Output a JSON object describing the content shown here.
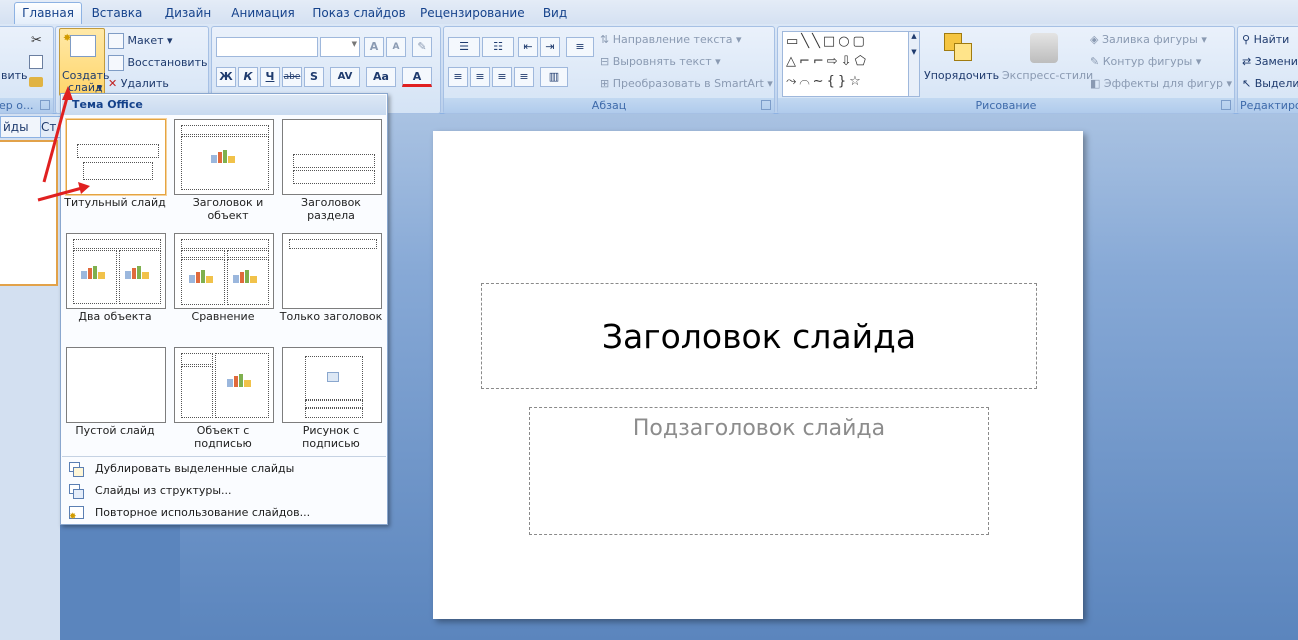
{
  "tabs": [
    "Главная",
    "Вставка",
    "Дизайн",
    "Анимация",
    "Показ слайдов",
    "Рецензирование",
    "Вид"
  ],
  "ribbon": {
    "clipboard": {
      "paste_partial": "вить",
      "group_partial": "ер о..."
    },
    "slides": {
      "create_line1": "Создать",
      "create_line2": "слайд",
      "layout": "Макет",
      "reset": "Восстановить",
      "delete": "Удалить"
    },
    "font": {
      "grow": "A",
      "shrink": "A",
      "bold": "Ж",
      "italic": "К",
      "underline": "Ч",
      "strike": "abe",
      "shadow": "S",
      "spacing": "AV",
      "case": "Aa",
      "color": "A"
    },
    "paragraph": {
      "text_direction": "Направление текста",
      "align_text": "Выровнять текст",
      "smartart": "Преобразовать в SmartArt",
      "label": "Абзац"
    },
    "drawing": {
      "arrange": "Упорядочить",
      "quick_styles": "Экспресс-стили",
      "shape_fill": "Заливка фигуры",
      "shape_outline": "Контур фигуры",
      "shape_effects": "Эффекты для фигур",
      "label": "Рисование"
    },
    "editing": {
      "find": "Найти",
      "replace": "Замени",
      "select": "Выдели",
      "label": "Редактиров"
    }
  },
  "left_panel": {
    "slides_tab": "йды",
    "outline_tab": "Ст"
  },
  "dropdown": {
    "header": "Тема Office",
    "layouts": [
      {
        "label": "Титульный слайд"
      },
      {
        "label": "Заголовок и объект"
      },
      {
        "label": "Заголовок раздела"
      },
      {
        "label": "Два объекта"
      },
      {
        "label": "Сравнение"
      },
      {
        "label": "Только заголовок"
      },
      {
        "label": "Пустой слайд"
      },
      {
        "label": "Объект с подписью"
      },
      {
        "label": "Рисунок с подписью"
      }
    ],
    "items": [
      "Дублировать выделенные слайды",
      "Слайды из структуры...",
      "Повторное использование слайдов..."
    ]
  },
  "slide": {
    "title": "Заголовок слайда",
    "subtitle": "Подзаголовок слайда"
  },
  "colors": {
    "annotation_arrow": "#e02020",
    "selection": "#e4a442",
    "ribbon": "#dbe7f6"
  }
}
